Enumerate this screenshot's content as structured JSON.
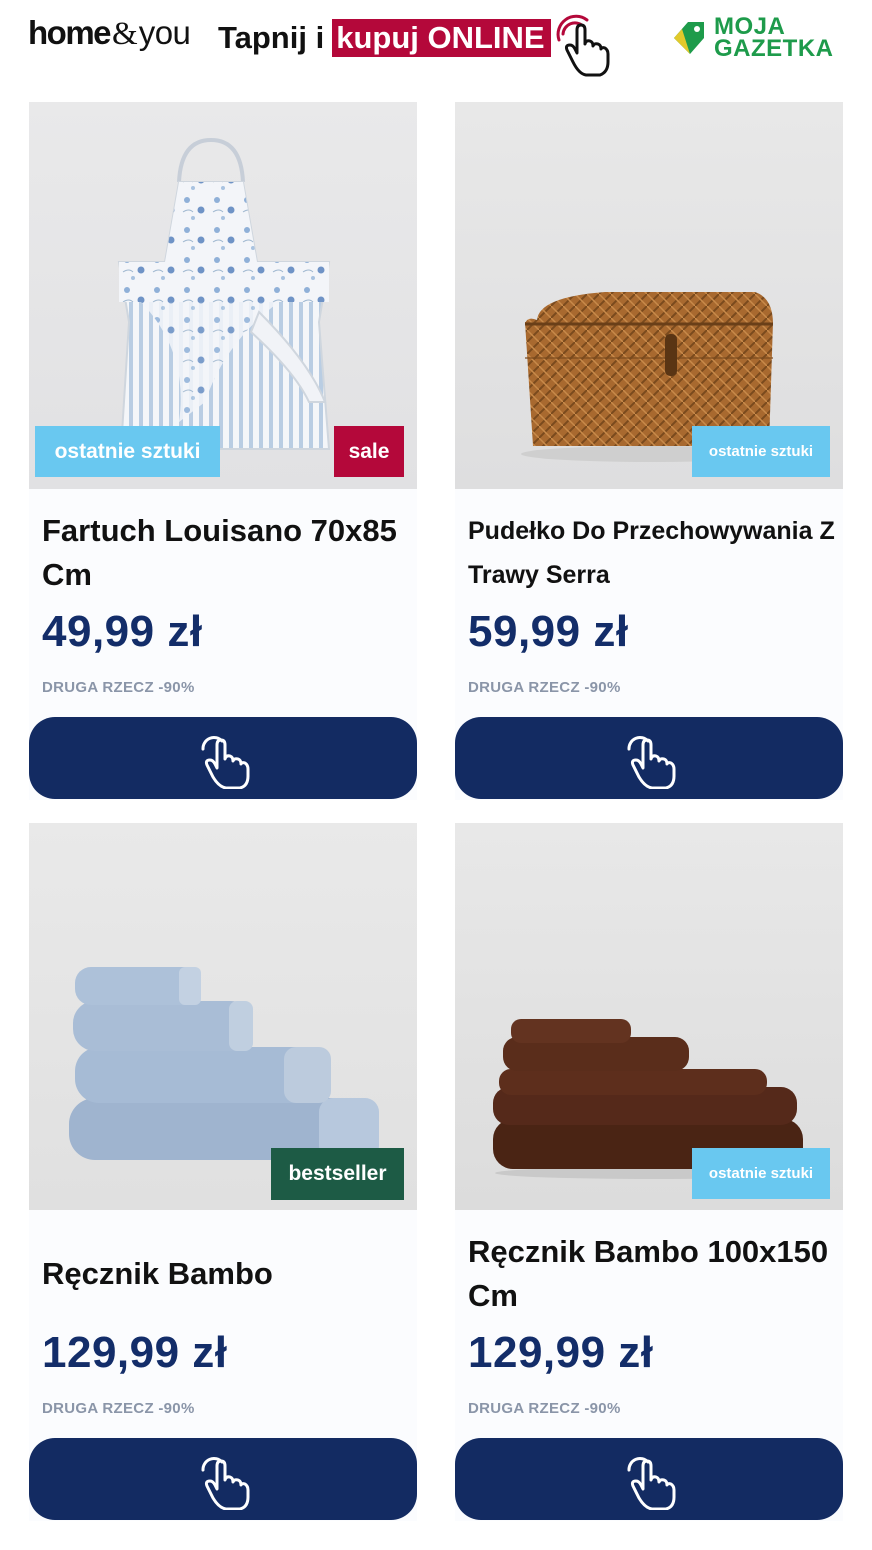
{
  "header": {
    "logo": {
      "home": "home",
      "amp": "&",
      "you": "you"
    },
    "tagline_plain": "Tapnij i",
    "tagline_highlight": "kupuj ONLINE",
    "moja_line1": "MOJA",
    "moja_line2": "GAZETKA"
  },
  "colors": {
    "brand_red": "#b4083a",
    "navy": "#132b62",
    "price_blue": "#132d69",
    "badge_light_blue": "#69c8f0",
    "badge_green": "#1d5b45",
    "moja_green": "#1e9b4b"
  },
  "products": [
    {
      "title": "Fartuch Louisano 70x85 Cm",
      "price": "49,99 zł",
      "promo": "DRUGA RZECZ -90%",
      "badges": [
        "ostatnie sztuki",
        "sale"
      ],
      "image": "apron-photo",
      "button_icon": "tap-hand-icon"
    },
    {
      "title": "Pudełko Do Przechowywania Z Trawy Serra",
      "price": "59,99 zł",
      "promo": "DRUGA RZECZ -90%",
      "badges": [
        "ostatnie sztuki"
      ],
      "image": "wicker-box-photo",
      "button_icon": "tap-hand-icon"
    },
    {
      "title": "Ręcznik Bambo",
      "price": "129,99 zł",
      "promo": "DRUGA RZECZ -90%",
      "badges": [
        "bestseller"
      ],
      "image": "blue-towels-photo",
      "button_icon": "tap-hand-icon"
    },
    {
      "title": "Ręcznik Bambo 100x150 Cm",
      "price": "129,99 zł",
      "promo": "DRUGA RZECZ -90%",
      "badges": [
        "ostatnie sztuki"
      ],
      "image": "brown-towels-photo",
      "button_icon": "tap-hand-icon"
    }
  ]
}
